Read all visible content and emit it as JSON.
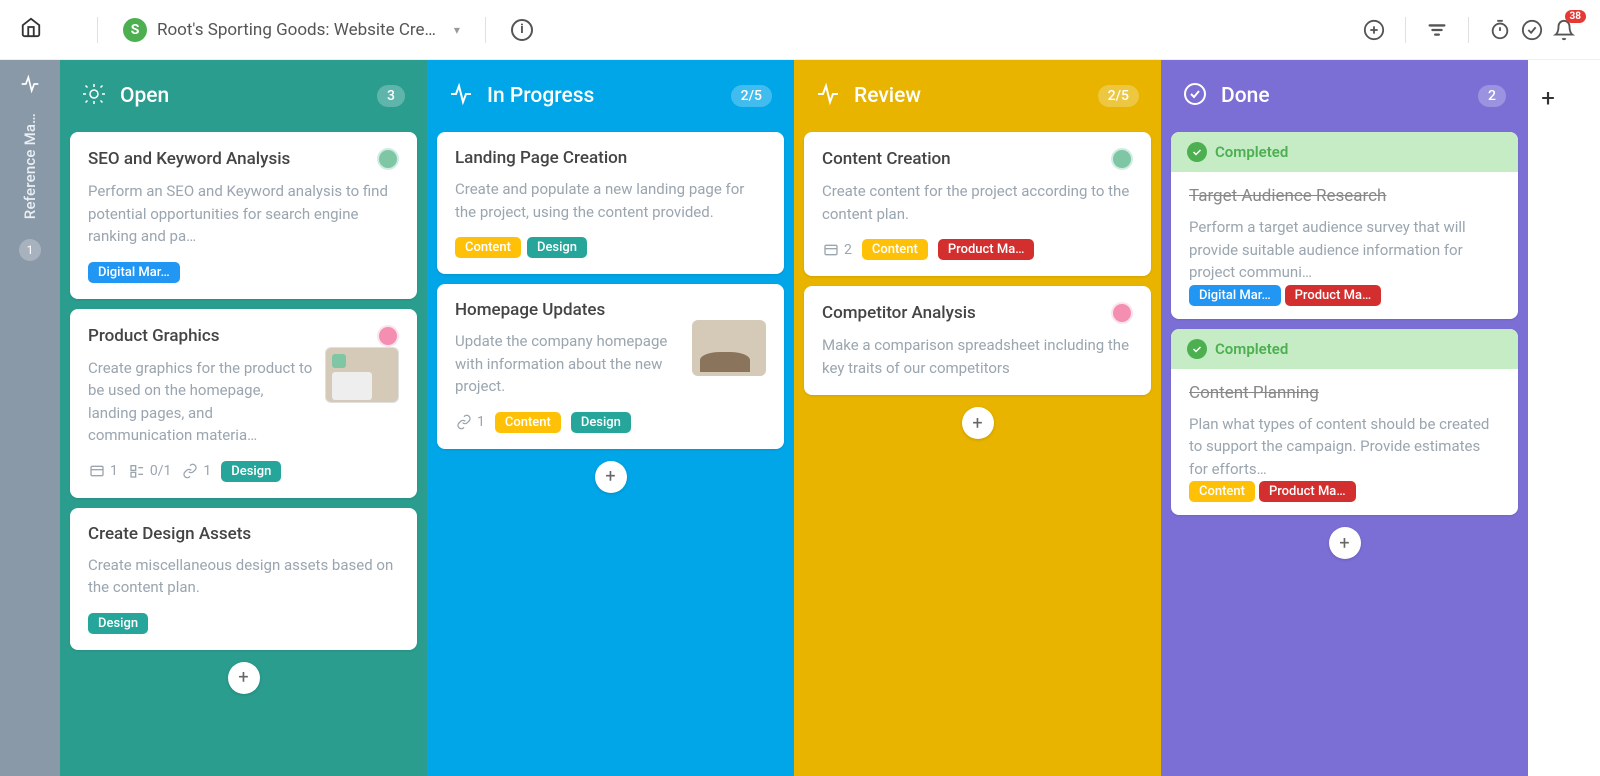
{
  "topbar": {
    "brand_initial": "S",
    "brand_title": "Root's Sporting Goods: Website Cre…",
    "notif_count": "38"
  },
  "sidebar": {
    "label": "Reference Ma…",
    "count": "1"
  },
  "columns": [
    {
      "key": "open",
      "title": "Open",
      "count": "3",
      "icon": "lightbulb",
      "color_class": "c-open",
      "cards": [
        {
          "title": "SEO and Keyword Analysis",
          "desc": "Perform an SEO and Keyword analysis to find potential opportunities for search engine ranking and pa…",
          "avatar_color": "#7fc6a4",
          "tags": [
            {
              "label": "Digital Mar…",
              "cls": "tag-blue"
            }
          ]
        },
        {
          "title": "Product Graphics",
          "desc": "Create graphics for the product to be used on the homepage, landing pages, and communication materia…",
          "avatar_color": "#f48fb1",
          "thumb": "graphics",
          "meta": [
            {
              "icon": "subtask",
              "text": "1"
            },
            {
              "icon": "checklist",
              "text": "0/1"
            },
            {
              "icon": "link",
              "text": "1"
            }
          ],
          "tags": [
            {
              "label": "Design",
              "cls": "tag-teal"
            }
          ]
        },
        {
          "title": "Create Design Assets",
          "desc": "Create miscellaneous design assets based on the content plan.",
          "tags": [
            {
              "label": "Design",
              "cls": "tag-teal"
            }
          ]
        }
      ]
    },
    {
      "key": "inprogress",
      "title": "In Progress",
      "count": "2/5",
      "icon": "pulse",
      "color_class": "c-prog",
      "cards": [
        {
          "title": "Landing Page Creation",
          "desc": "Create and populate a new landing page for the project, using the content provided.",
          "tags": [
            {
              "label": "Content",
              "cls": "tag-yellow"
            },
            {
              "label": "Design",
              "cls": "tag-teal"
            }
          ]
        },
        {
          "title": "Homepage Updates",
          "desc": "Update the company homepage with information about the new project.",
          "thumb": "horses",
          "meta": [
            {
              "icon": "link",
              "text": "1"
            }
          ],
          "tags": [
            {
              "label": "Content",
              "cls": "tag-yellow"
            },
            {
              "label": "Design",
              "cls": "tag-teal"
            }
          ]
        }
      ]
    },
    {
      "key": "review",
      "title": "Review",
      "count": "2/5",
      "icon": "pulse",
      "color_class": "c-review",
      "cards": [
        {
          "title": "Content Creation",
          "desc": "Create content for the project according to the content plan.",
          "avatar_color": "#7fc6a4",
          "meta": [
            {
              "icon": "subtask",
              "text": "2"
            }
          ],
          "tags": [
            {
              "label": "Content",
              "cls": "tag-yellow"
            },
            {
              "label": "Product Ma…",
              "cls": "tag-red"
            }
          ]
        },
        {
          "title": "Competitor Analysis",
          "desc": "Make a comparison spreadsheet including the key traits of our competitors",
          "avatar_color": "#f48fb1"
        }
      ]
    },
    {
      "key": "done",
      "title": "Done",
      "count": "2",
      "icon": "check",
      "color_class": "c-done",
      "done_cards": [
        {
          "banner": "Completed",
          "title": "Target Audience Research",
          "desc": "Perform a target audience survey that will provide suitable audience information for project communi…",
          "tags": [
            {
              "label": "Digital Mar…",
              "cls": "tag-blue"
            },
            {
              "label": "Product Ma…",
              "cls": "tag-red"
            }
          ]
        },
        {
          "banner": "Completed",
          "title": "Content Planning",
          "desc": "Plan what types of content should be created to support the campaign. Provide estimates for efforts…",
          "tags": [
            {
              "label": "Content",
              "cls": "tag-yellow"
            },
            {
              "label": "Product Ma…",
              "cls": "tag-red"
            }
          ]
        }
      ]
    }
  ]
}
